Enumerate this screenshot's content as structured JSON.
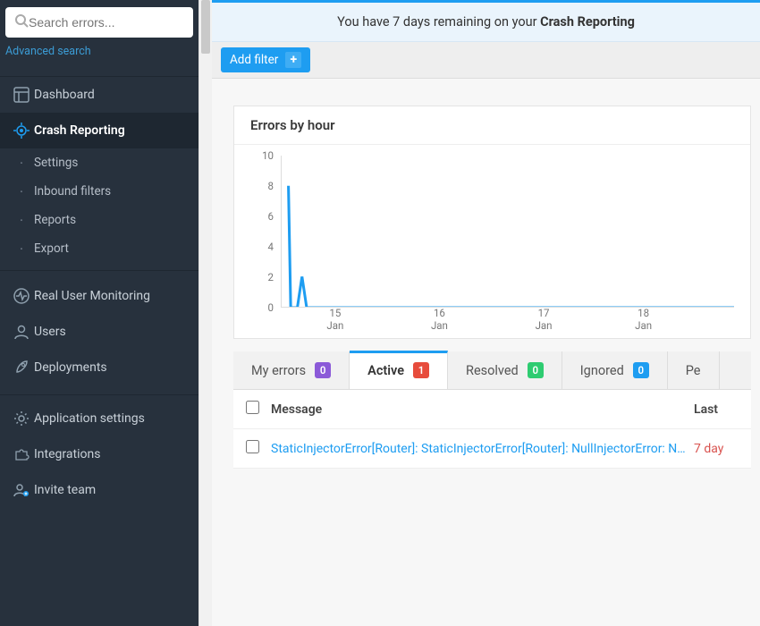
{
  "search": {
    "placeholder": "Search errors..."
  },
  "advanced_search": "Advanced search",
  "sidebar": {
    "items": [
      {
        "key": "dashboard",
        "label": "Dashboard"
      },
      {
        "key": "crash",
        "label": "Crash Reporting",
        "active": true
      },
      {
        "key": "rum",
        "label": "Real User Monitoring"
      },
      {
        "key": "users",
        "label": "Users"
      },
      {
        "key": "deployments",
        "label": "Deployments"
      }
    ],
    "sub_crash": [
      {
        "label": "Settings"
      },
      {
        "label": "Inbound filters"
      },
      {
        "label": "Reports"
      },
      {
        "label": "Export"
      }
    ],
    "bottom": [
      {
        "key": "appsettings",
        "label": "Application settings"
      },
      {
        "key": "integrations",
        "label": "Integrations"
      },
      {
        "key": "invite",
        "label": "Invite team"
      }
    ]
  },
  "banner": {
    "prefix": "You have 7 days remaining on your ",
    "bold": "Crash Reporting"
  },
  "add_filter": "Add filter",
  "chart_data": {
    "type": "line",
    "title": "Errors by hour",
    "xlabel": "",
    "ylabel": "",
    "ylim": [
      0,
      10
    ],
    "y_ticks": [
      0,
      2,
      4,
      6,
      8,
      10
    ],
    "x_display_ticks": [
      {
        "pos": 0.12,
        "top": "15",
        "bot": "Jan"
      },
      {
        "pos": 0.35,
        "top": "16",
        "bot": "Jan"
      },
      {
        "pos": 0.58,
        "top": "17",
        "bot": "Jan"
      },
      {
        "pos": 0.8,
        "top": "18",
        "bot": "Jan"
      }
    ],
    "series": [
      {
        "name": "errors",
        "color": "#1e9df1",
        "points_pct": [
          [
            0.015,
            0.2
          ],
          [
            0.02,
            1.0
          ],
          [
            0.035,
            1.0
          ],
          [
            0.045,
            0.8
          ],
          [
            0.055,
            1.0
          ],
          [
            0.06,
            1.0
          ],
          [
            1.0,
            1.0
          ]
        ]
      }
    ],
    "values_estimate": {
      "Jan 14 20h": 8,
      "Jan 14 22h": 2,
      "else": 0
    }
  },
  "tabs": [
    {
      "label": "My errors",
      "count": "0",
      "color": "#8b5ad8"
    },
    {
      "label": "Active",
      "count": "1",
      "color": "#e74c3c",
      "active": true
    },
    {
      "label": "Resolved",
      "count": "0",
      "color": "#2ecc71"
    },
    {
      "label": "Ignored",
      "count": "0",
      "color": "#1e9df1"
    },
    {
      "label": "Pe"
    }
  ],
  "table": {
    "headers": {
      "message": "Message",
      "last": "Last"
    },
    "rows": [
      {
        "message": "StaticInjectorError[Router]: StaticInjectorError[Router]: NullInjectorError: N…",
        "last": "7 day"
      }
    ]
  },
  "colors": {
    "accent": "#1e9df1",
    "sidebar_bg": "#27313d",
    "danger": "#e74c3c"
  }
}
